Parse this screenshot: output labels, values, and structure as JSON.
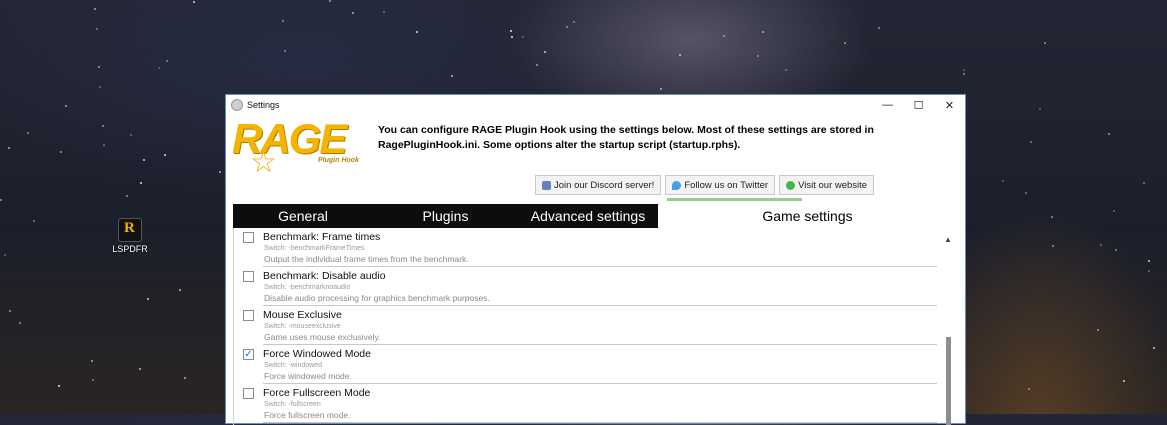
{
  "desktop": {
    "icon_label": "LSPDFR"
  },
  "window": {
    "title": "Settings",
    "controls": {
      "minimize": "—",
      "maximize": "☐",
      "close": "✕"
    }
  },
  "header": {
    "logo_text": "RAGE",
    "logo_subtext": "Plugin Hook",
    "intro": "You can configure RAGE Plugin Hook using the settings below. Most of these settings are stored in RagePluginHook.ini. Some options alter the startup script (startup.rphs)."
  },
  "links": {
    "discord": "Join our Discord server!",
    "twitter": "Follow us on Twitter",
    "website": "Visit our website"
  },
  "tabs": [
    {
      "label": "General"
    },
    {
      "label": "Plugins"
    },
    {
      "label": "Advanced settings"
    },
    {
      "label": "Game settings"
    }
  ],
  "active_tab": "Game settings",
  "settings": [
    {
      "name": "Benchmark: Frame times",
      "switch": "Switch: -benchmarkFrameTimes",
      "desc": "Output the individual frame times from the benchmark.",
      "checked": false
    },
    {
      "name": "Benchmark: Disable audio",
      "switch": "Switch: -benchmarknoaudio",
      "desc": "Disable audio processing for graphics benchmark purposes.",
      "checked": false
    },
    {
      "name": "Mouse Exclusive",
      "switch": "Switch: -mouseexclusive",
      "desc": "Game uses mouse exclusively.",
      "checked": false
    },
    {
      "name": "Force Windowed Mode",
      "switch": "Switch: -windowed",
      "desc": "Force windowed mode.",
      "checked": true
    },
    {
      "name": "Force Fullscreen Mode",
      "switch": "Switch: -fullscreen",
      "desc": "Force fullscreen mode.",
      "checked": false
    }
  ],
  "colors": {
    "logo": "#f4b400",
    "tab_bar": "#0d0d0d",
    "checkmark": "#1e6fc8",
    "highlight": "#8fd18a"
  }
}
